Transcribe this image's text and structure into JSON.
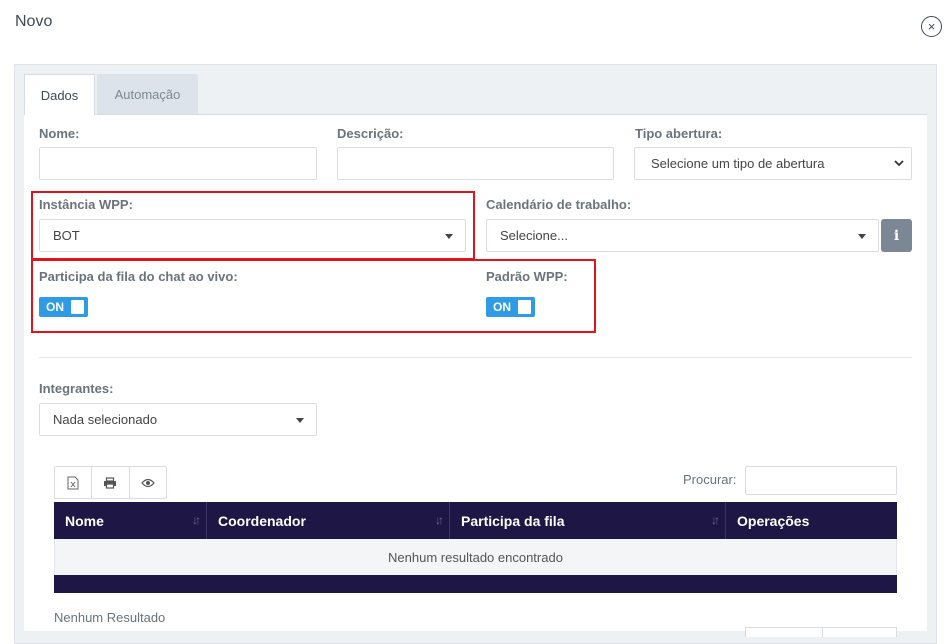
{
  "modal": {
    "title": "Novo",
    "close_icon": "×"
  },
  "tabs": [
    {
      "label": "Dados",
      "active": true
    },
    {
      "label": "Automação",
      "active": false
    }
  ],
  "form": {
    "nome": {
      "label": "Nome:",
      "value": ""
    },
    "descricao": {
      "label": "Descrição:",
      "value": ""
    },
    "tipo_abertura": {
      "label": "Tipo abertura:",
      "selected": "Selecione um tipo de abertura"
    },
    "instancia_wpp": {
      "label": "Instância WPP:",
      "selected": "BOT"
    },
    "calendario": {
      "label": "Calendário de trabalho:",
      "selected": "Selecione...",
      "info_icon": "i"
    },
    "participa_fila": {
      "label": "Participa da fila do chat ao vivo:",
      "toggle": "ON",
      "on": true
    },
    "padrao_wpp": {
      "label": "Padrão WPP:",
      "toggle": "ON",
      "on": true
    },
    "integrantes": {
      "label": "Integrantes:",
      "selected": "Nada selecionado"
    }
  },
  "table": {
    "toolbar_icons": [
      "excel-icon",
      "print-icon",
      "eye-icon"
    ],
    "search_label": "Procurar:",
    "search_value": "",
    "columns": [
      "Nome",
      "Coordenador",
      "Participa da fila",
      "Operações"
    ],
    "empty_message": "Nenhum resultado encontrado",
    "footer_text": "Nenhum Resultado"
  },
  "colors": {
    "table_header": "#1e1745",
    "toggle_on": "#2f9be4",
    "highlight_box": "#e0151c",
    "info_button": "#7b8794"
  }
}
